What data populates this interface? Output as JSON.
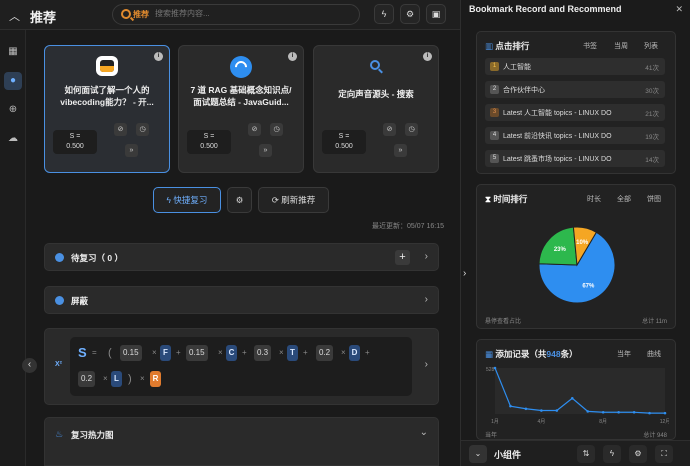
{
  "header": {
    "title": "推荐",
    "search_tag": "推荐",
    "search_placeholder": "搜索推荐内容..."
  },
  "cards": [
    {
      "title": "如何面试了解一个人的vibecoding能力？ - 开...",
      "score_label": "S =",
      "score": "0.500"
    },
    {
      "title": "7 道 RAG 基础概念知识点/面试题总结 - JavaGuid...",
      "score_label": "S =",
      "score": "0.500"
    },
    {
      "title": "定向声音源头 - 搜索",
      "score_label": "S =",
      "score": "0.500"
    }
  ],
  "actions": {
    "quick_review": "快捷复习",
    "refresh": "刷新推荐"
  },
  "updated": "最近更新：05/07 16:15",
  "sections": {
    "pending": "待复习（ 0 ）",
    "blocked": "屏蔽",
    "heatmap": "复习热力图"
  },
  "formula": {
    "s": "S",
    "eq": "=",
    "lp": "(",
    "rp": ")",
    "c1": "0.15",
    "v1": "F",
    "c2": "0.15",
    "v2": "C",
    "c3": "0.3",
    "v3": "T",
    "c4": "0.2",
    "v4": "D",
    "c5": "0.2",
    "v5": "L",
    "v6": "R",
    "times": "×",
    "plus": "+",
    "badge": "X²"
  },
  "right": {
    "title": "Bookmark Record and Recommend",
    "clicks": {
      "title": "点击排行",
      "tabs": [
        "书签",
        "当周",
        "列表"
      ],
      "rows": [
        {
          "n": "1",
          "t": "人工智能",
          "c": "41次"
        },
        {
          "n": "2",
          "t": "合作伙伴中心",
          "c": "30次"
        },
        {
          "n": "3",
          "t": "Latest 人工智能 topics - LINUX DO",
          "c": "21次"
        },
        {
          "n": "4",
          "t": "Latest 前沿快讯 topics - LINUX DO",
          "c": "19次"
        },
        {
          "n": "5",
          "t": "Latest 跳蚤市场 topics - LINUX DO",
          "c": "14次"
        }
      ]
    },
    "time": {
      "title": "时间排行",
      "tabs": [
        "时长",
        "全部",
        "饼图"
      ],
      "footer_left": "悬停查看占比",
      "footer_right": "总计 11m"
    },
    "added": {
      "title_pre": "添加记录（共",
      "count": "948",
      "title_post": "条）",
      "tabs": [
        "当年",
        "曲线"
      ],
      "footer_left": "当年",
      "footer_right": "总计 948"
    },
    "footer_label": "小组件"
  },
  "chart_data": [
    {
      "type": "pie",
      "title": "时间排行",
      "values": [
        67,
        23,
        10
      ],
      "labels": [
        "67%",
        "23%",
        "10%"
      ],
      "colors": [
        "#2e8ef0",
        "#2db84d",
        "#f5a623"
      ]
    },
    {
      "type": "line",
      "title": "添加记录",
      "x": [
        "1月",
        "4月",
        "8月",
        "12月"
      ],
      "ylabel": "",
      "ymax_label": "528",
      "points": [
        528,
        90,
        60,
        40,
        40,
        180,
        30,
        20,
        20,
        20,
        10,
        10
      ]
    }
  ]
}
